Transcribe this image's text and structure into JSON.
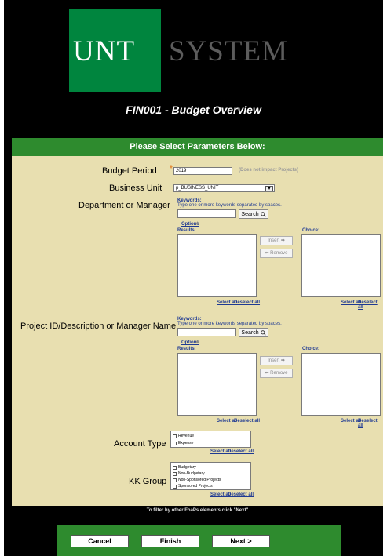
{
  "header": {
    "logo_unt": "UNT",
    "logo_system": "SYSTEM",
    "report_title": "FIN001 - Budget Overview",
    "params_bar": "Please Select Parameters Below:"
  },
  "form": {
    "budget_period": {
      "label": "Budget Period",
      "required_mark": "*",
      "value": "2019",
      "hint": "(Does not impact Projects)"
    },
    "business_unit": {
      "label": "Business Unit",
      "value": "p_BUSINESS_UNIT",
      "arrow": "▾"
    },
    "department": {
      "label": "Department or Manager",
      "keywords_label": "Keywords:",
      "keywords_hint": "Type one or more keywords separated by spaces.",
      "search_label": "Search",
      "options_label": "Options",
      "results_label": "Results:",
      "choice_label": "Choice:",
      "insert_label": "Insert ➡",
      "remove_label": "⬅ Remove",
      "results_select_all": "Select all",
      "results_deselect_all": "Deselect all",
      "choice_select_all": "Select all",
      "choice_deselect_all": "Deselect all"
    },
    "project": {
      "label": "Project ID/Description or Manager Name",
      "keywords_label": "Keywords:",
      "keywords_hint": "Type one or more keywords separated by spaces.",
      "search_label": "Search",
      "options_label": "Options",
      "results_label": "Results:",
      "choice_label": "Choice:",
      "insert_label": "Insert ➡",
      "remove_label": "⬅ Remove",
      "results_select_all": "Select all",
      "results_deselect_all": "Deselect all",
      "choice_select_all": "Select all",
      "choice_deselect_all": "Deselect all"
    },
    "account_type": {
      "label": "Account Type",
      "options": [
        "Revenue",
        "Expense"
      ],
      "select_all": "Select all",
      "deselect_all": "Deselect all"
    },
    "kk_group": {
      "label": "KK Group",
      "options": [
        "Budgetary",
        "Non-Budgetary",
        "Non-Sponsored Projects",
        "Sponsored Projects"
      ],
      "select_all": "Select all",
      "deselect_all": "Deselect all"
    }
  },
  "footer": {
    "note": "To filter by other FoaPs elements click \"Next\"",
    "cancel": "Cancel",
    "finish": "Finish",
    "next": "Next >"
  },
  "colors": {
    "brand_green": "#00853e",
    "bar_green": "#2e8b2e",
    "panel_tan": "#e8dfb0"
  }
}
